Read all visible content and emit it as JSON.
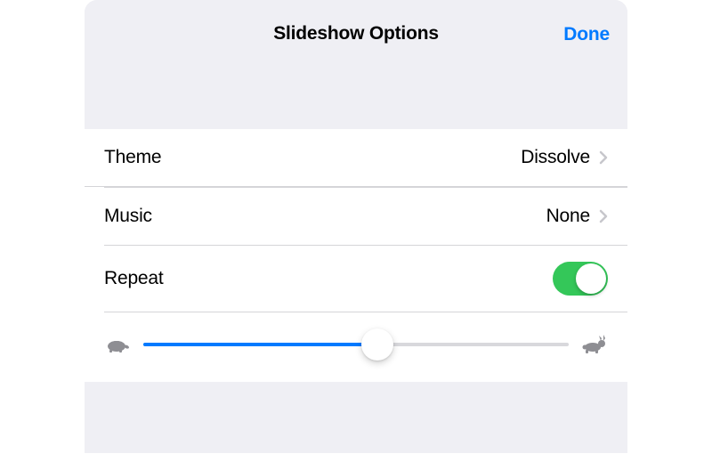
{
  "header": {
    "title": "Slideshow Options",
    "done_label": "Done"
  },
  "rows": {
    "theme": {
      "label": "Theme",
      "value": "Dissolve"
    },
    "music": {
      "label": "Music",
      "value": "None"
    },
    "repeat": {
      "label": "Repeat",
      "on": true
    }
  },
  "slider": {
    "percent": 55,
    "slow_icon": "turtle-icon",
    "fast_icon": "rabbit-icon"
  },
  "colors": {
    "accent": "#007aff",
    "toggle_on": "#34c759",
    "sheet_bg": "#efeff4",
    "separator": "#d5d5d8",
    "secondary": "#8e8e93"
  }
}
